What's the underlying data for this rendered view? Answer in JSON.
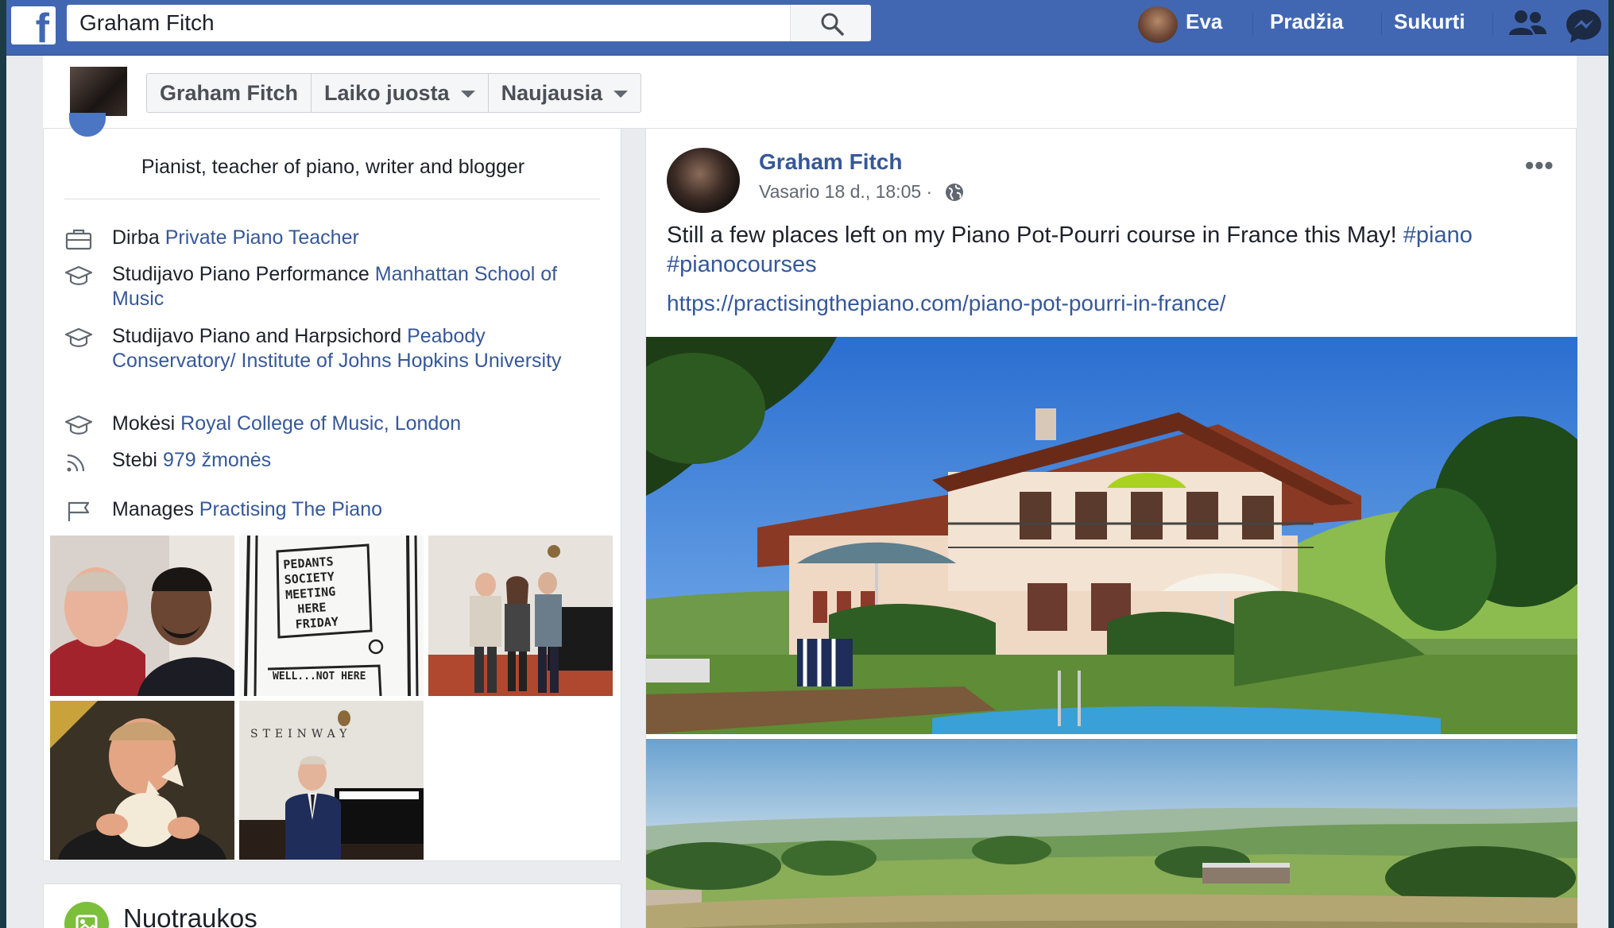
{
  "topbar": {
    "search_value": "Graham Fitch",
    "user_name": "Eva",
    "nav_home": "Pradžia",
    "nav_create": "Sukurti"
  },
  "subheader": {
    "buttons": [
      "Graham Fitch",
      "Laiko juosta",
      "Naujausia"
    ]
  },
  "intro": {
    "bio": "Pianist, teacher of piano, writer and blogger",
    "items": [
      {
        "icon": "briefcase-icon",
        "prefix": "Dirba ",
        "link": "Private Piano Teacher"
      },
      {
        "icon": "graduation-cap-icon",
        "prefix": "Studijavo Piano Performance ",
        "link": "Manhattan School of Music"
      },
      {
        "icon": "graduation-cap-icon",
        "prefix": "Studijavo Piano and Harpsichord ",
        "link": "Peabody Conservatory/ Institute of Johns Hopkins University"
      },
      {
        "icon": "graduation-cap-icon",
        "prefix": "Mokėsi ",
        "link": "Royal College of Music, London"
      },
      {
        "icon": "rss-icon",
        "prefix": "Stebi ",
        "link": "979 žmonės"
      },
      {
        "icon": "flag-icon",
        "prefix": "Manages ",
        "link": "Practising The Piano"
      }
    ],
    "sketch_text": [
      "PEDANTS",
      "SOCIETY",
      "MEETING",
      "HERE",
      "FRIDAY"
    ],
    "sketch_bottom": "WELL...NOT HERE"
  },
  "photos_section": {
    "title": "Nuotraukos"
  },
  "post": {
    "author": "Graham Fitch",
    "timestamp": "Vasario 18 d., 18:05 ·",
    "more": "•••",
    "text": "Still a few places left on my Piano Pot-Pourri course in France this May! ",
    "hashtag1": "#piano",
    "hashtag2": "#pianocourses",
    "link": "https://practisingthepiano.com/piano-pot-pourri-in-france/"
  },
  "colors": {
    "brand_blue": "#4267b2",
    "link_blue": "#365899",
    "background": "#e9ebee"
  }
}
